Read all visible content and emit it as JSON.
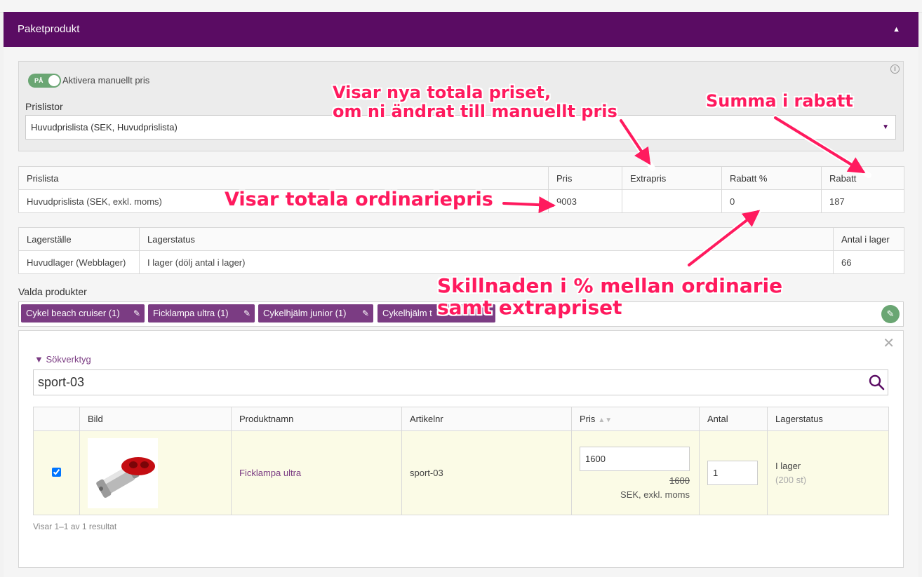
{
  "panel": {
    "title": "Paketprodukt"
  },
  "manual_price": {
    "toggle_label": "PÅ",
    "toggle_text": "Aktivera manuellt pris"
  },
  "pricelists": {
    "label": "Prislistor",
    "selected": "Huvudprislista (SEK, Huvudprislista)"
  },
  "price_table": {
    "headers": [
      "Prislista",
      "Pris",
      "Extrapris",
      "Rabatt %",
      "Rabatt"
    ],
    "row": [
      "Huvudprislista (SEK, exkl. moms)",
      "9003",
      "",
      "0",
      "187"
    ]
  },
  "stock_table": {
    "headers": [
      "Lagerställe",
      "Lagerstatus",
      "Antal i lager"
    ],
    "row": [
      "Huvudlager (Webblager)",
      "I lager (dölj antal i lager)",
      "66"
    ]
  },
  "selected_products": {
    "label": "Valda produkter",
    "tags": [
      "Cykel beach cruiser (1)",
      "Ficklampa ultra (1)",
      "Cykelhjälm junior (1)",
      "Cykelhjälm t"
    ]
  },
  "search": {
    "title": "Sökverktyg",
    "query": "sport-03"
  },
  "results_table": {
    "headers": [
      "",
      "Bild",
      "Produktnamn",
      "Artikelnr",
      "Pris",
      "Antal",
      "Lagerstatus"
    ],
    "row": {
      "name": "Ficklampa ultra",
      "sku": "sport-03",
      "price_input": "1600",
      "old_price": "1600",
      "currency": "SEK, exkl. moms",
      "qty": "1",
      "stock": "I lager",
      "stock_count": "(200 st)"
    },
    "count_text": "Visar 1–1 av 1 resultat"
  },
  "annotations": {
    "new_total_1": "Visar nya totala priset,",
    "new_total_2": "om ni ändrat till manuellt pris",
    "discount_sum": "Summa i rabatt",
    "ordinary": "Visar totala ordinariepris",
    "diff_1": "Skillnaden i % mellan ordinarie",
    "diff_2": "samt extrapriset"
  },
  "colors": {
    "header": "#5a0c63",
    "accent": "#7b3c83",
    "toggle": "#6aa673",
    "annotation": "#ff1a5e",
    "highlight_row": "#fbfbe6"
  }
}
